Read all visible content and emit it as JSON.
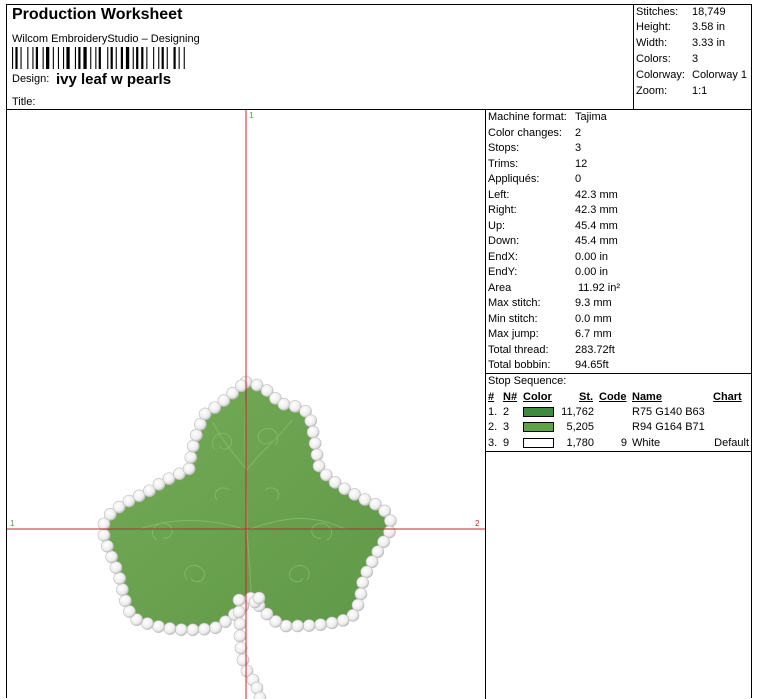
{
  "header": {
    "title": "Production Worksheet",
    "software": "Wilcom EmbroideryStudio – Designing",
    "design_label": "Design:",
    "design_name": "ivy leaf w pearls",
    "title_label": "Title:"
  },
  "stats": [
    {
      "label": "Stitches:",
      "value": "18,749"
    },
    {
      "label": "Height:",
      "value": "3.58 in"
    },
    {
      "label": "Width:",
      "value": "3.33 in"
    },
    {
      "label": "Colors:",
      "value": "3"
    },
    {
      "label": "Colorway:",
      "value": "Colorway 1"
    },
    {
      "label": "Zoom:",
      "value": "1:1"
    }
  ],
  "properties": [
    {
      "label": "Machine format:",
      "value": "Tajima"
    },
    {
      "label": "Color changes:",
      "value": "2"
    },
    {
      "label": "Stops:",
      "value": "3"
    },
    {
      "label": "Trims:",
      "value": "12"
    },
    {
      "label": "Appliqués:",
      "value": "0"
    },
    {
      "label": "Left:",
      "value": "42.3 mm"
    },
    {
      "label": "Right:",
      "value": "42.3 mm"
    },
    {
      "label": "Up:",
      "value": "45.4 mm"
    },
    {
      "label": "Down:",
      "value": "45.4 mm"
    },
    {
      "label": "EndX:",
      "value": "0.00 in"
    },
    {
      "label": "EndY:",
      "value": "0.00 in"
    },
    {
      "label": "Area",
      "value": "11.92 in²"
    },
    {
      "label": "Max stitch:",
      "value": "9.3 mm"
    },
    {
      "label": "Min stitch:",
      "value": "0.0 mm"
    },
    {
      "label": "Max jump:",
      "value": "6.7 mm"
    },
    {
      "label": "Total thread:",
      "value": "283.72ft"
    },
    {
      "label": "Total bobbin:",
      "value": "94.65ft"
    }
  ],
  "stop_sequence": {
    "title": "Stop Sequence:",
    "headers": {
      "num": "#",
      "n": "N#",
      "color": "Color",
      "st": "St.",
      "code": "Code",
      "name": "Name",
      "chart": "Chart"
    },
    "rows": [
      {
        "num": "1.",
        "n": "2",
        "swatch": "#3f8a3e",
        "st": "11,762",
        "code": "",
        "name": "R75 G140 B63",
        "chart": ""
      },
      {
        "num": "2.",
        "n": "3",
        "swatch": "#5ea447",
        "st": "5,205",
        "code": "",
        "name": "R94 G164 B71",
        "chart": ""
      },
      {
        "num": "3.",
        "n": "9",
        "swatch": "#ffffff",
        "st": "1,780",
        "code": "9",
        "name": "White",
        "chart": "Default"
      }
    ]
  },
  "canvas": {
    "axis_markers": {
      "top": "1",
      "left": "1",
      "right": "2"
    },
    "leaf_color": "#6aa24f",
    "pearl_color": "#f4f4f4",
    "crosshair_color": "#c0282c"
  }
}
